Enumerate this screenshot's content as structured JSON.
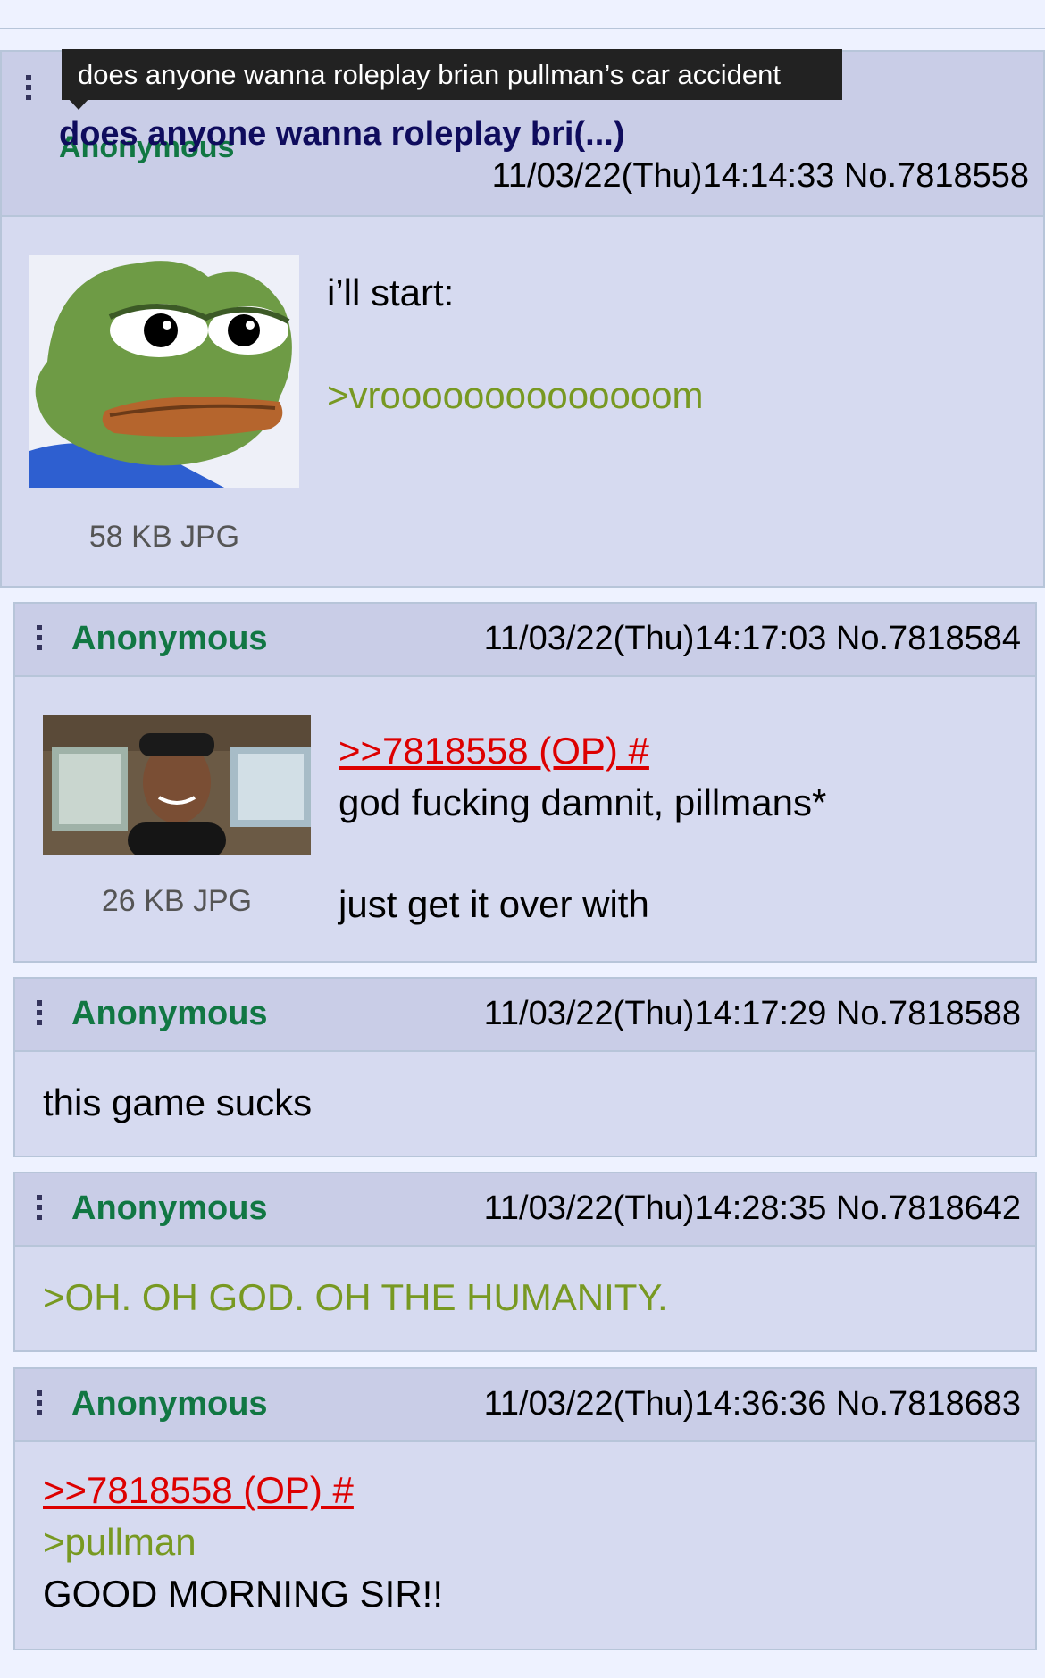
{
  "tooltip": "does anyone wanna roleplay brian pullman’s car accident",
  "op": {
    "name": "Anonymous",
    "subject": "does anyone wanna roleplay bri(...)",
    "datetime": "11/03/22(Thu)14:14:33 No.7818558",
    "file_info": "58 KB JPG",
    "lines": [
      "i’ll start:",
      ">vroooooooooooooom"
    ]
  },
  "replies": [
    {
      "name": "Anonymous",
      "datetime": "11/03/22(Thu)14:17:03 No.7818584",
      "file_info": "26 KB JPG",
      "quotelink": ">>7818558 (OP) #",
      "lines": [
        "god fucking damnit, pillmans*",
        "just get it over with"
      ]
    },
    {
      "name": "Anonymous",
      "datetime": "11/03/22(Thu)14:17:29 No.7818588",
      "lines": [
        "this game sucks"
      ]
    },
    {
      "name": "Anonymous",
      "datetime": "11/03/22(Thu)14:28:35 No.7818642",
      "lines": [
        ">OH. OH GOD. OH THE HUMANITY."
      ]
    },
    {
      "name": "Anonymous",
      "datetime": "11/03/22(Thu)14:36:36 No.7818683",
      "quotelink": ">>7818558 (OP) #",
      "lines": [
        ">pullman",
        "GOOD MORNING SIR!!"
      ]
    }
  ],
  "colors": {
    "background": "#eef2ff",
    "post_bg": "#d6daf0",
    "name_green": "#117743",
    "greentext": "#789922",
    "quotelink_red": "#dd0000",
    "subject_navy": "#0f0c5d"
  },
  "icons": [
    "menu-dots-icon"
  ]
}
